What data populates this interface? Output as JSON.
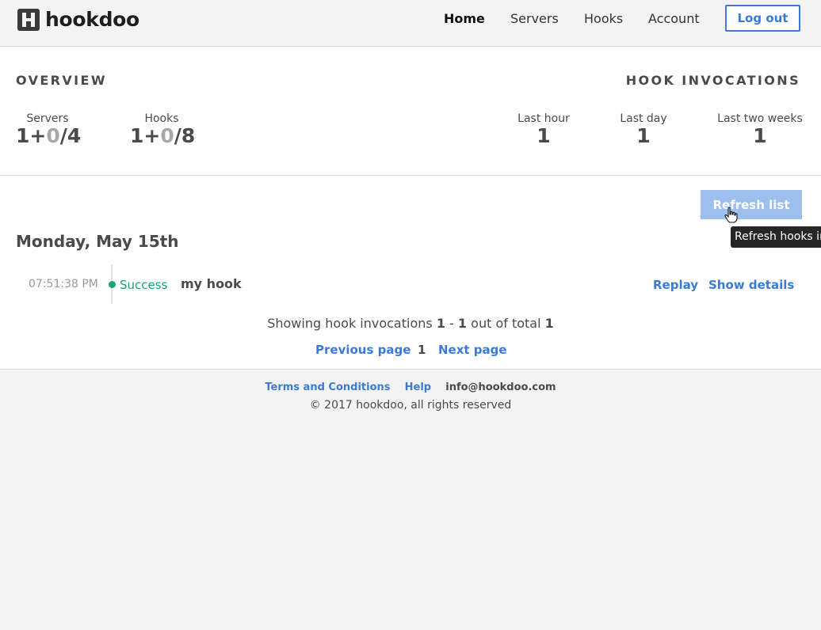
{
  "header": {
    "brand": "hookdoo",
    "nav": [
      "Home",
      "Servers",
      "Hooks",
      "Account"
    ],
    "logout_label": "Log out"
  },
  "overview": {
    "title": "OVERVIEW",
    "servers": {
      "label": "Servers",
      "a": "1",
      "sep1": "+",
      "b": "0",
      "sep2": "/",
      "c": "4"
    },
    "hooks": {
      "label": "Hooks",
      "a": "1",
      "sep1": "+",
      "b": "0",
      "sep2": "/",
      "c": "8"
    }
  },
  "invocations": {
    "title": "HOOK INVOCATIONS",
    "last_hour": {
      "label": "Last hour",
      "value": "1"
    },
    "last_day": {
      "label": "Last day",
      "value": "1"
    },
    "last_two_weeks": {
      "label": "Last two weeks",
      "value": "1"
    }
  },
  "list": {
    "refresh_label": "Refresh list",
    "tooltip": "Refresh hooks invocations list",
    "day_heading": "Monday, May 15th",
    "items": [
      {
        "time": "07:51:38 PM",
        "status": "Success",
        "name": "my hook",
        "replay": "Replay",
        "details": "Show details"
      }
    ],
    "summary": {
      "prefix": "Showing hook invocations",
      "from": "1",
      "dash": "-",
      "to": "1",
      "middle": "out of total",
      "total": "1"
    },
    "pager": {
      "prev": "Previous page",
      "page": "1",
      "next": "Next page"
    }
  },
  "footer": {
    "terms": "Terms and Conditions",
    "help": "Help",
    "email": "info@hookdoo.com",
    "copyright": "© 2017 hookdoo, all rights reserved"
  },
  "colors": {
    "accent": "#3a7bd5",
    "success": "#1aa37a",
    "refresh_disabled": "#9cbfee",
    "background": "#f3f3f3"
  },
  "icons": [
    "logo-h-icon",
    "hand-cursor-icon"
  ]
}
